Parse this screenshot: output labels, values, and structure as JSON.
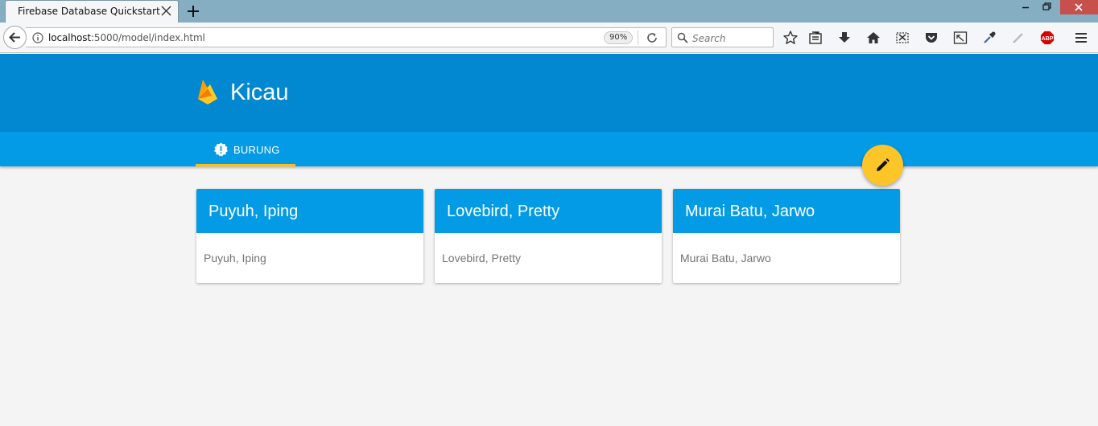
{
  "browser": {
    "tab_title": "Firebase Database Quickstart",
    "url_host": "localhost",
    "url_rest": ":5000/model/index.html",
    "zoom": "90%",
    "search_placeholder": "Search"
  },
  "app": {
    "title": "Kicau",
    "tab_label": "BURUNG",
    "accent_color": "#ffc107",
    "header_color": "#0288d1",
    "tab_color": "#039be5"
  },
  "cards": [
    {
      "title": "Puyuh, Iping",
      "body": "Puyuh, Iping"
    },
    {
      "title": "Lovebird, Pretty",
      "body": "Lovebird, Pretty"
    },
    {
      "title": "Murai Batu, Jarwo",
      "body": "Murai Batu, Jarwo"
    }
  ],
  "icons": [
    "close-icon",
    "plus-icon",
    "back-arrow-icon",
    "info-icon",
    "reload-icon",
    "search-icon",
    "bookmark-star-icon",
    "reading-list-icon",
    "download-icon",
    "home-icon",
    "screenshot-icon",
    "pocket-icon",
    "responsive-design-icon",
    "eyedropper-icon",
    "pen-icon",
    "adblock-icon",
    "hamburger-menu-icon",
    "firebase-logo",
    "alert-icon",
    "edit-pencil-icon"
  ]
}
